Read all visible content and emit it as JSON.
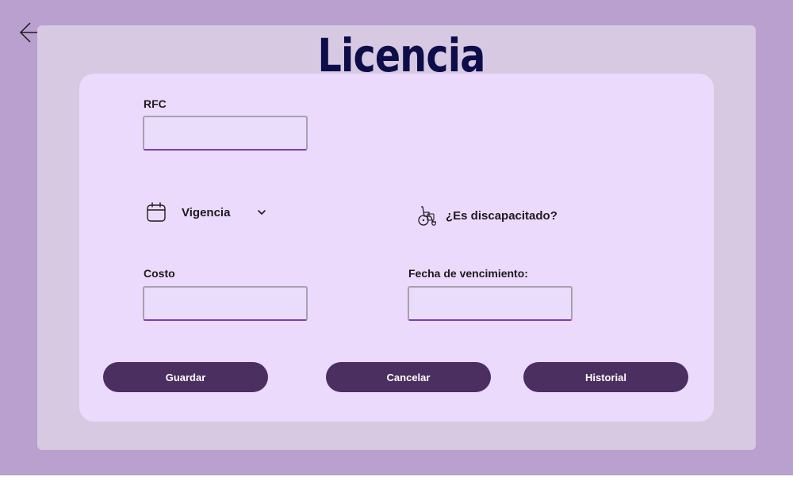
{
  "header": {
    "title": "Licencia",
    "back_icon": "arrow-left-icon"
  },
  "form": {
    "rfc": {
      "label": "RFC",
      "value": "",
      "placeholder": ""
    },
    "vigencia": {
      "label": "Vigencia",
      "icon": "calendar-icon",
      "chevron_icon": "chevron-down-icon"
    },
    "discapacitado": {
      "label": "¿Es discapacitado?",
      "icon": "wheelchair-icon"
    },
    "costo": {
      "label": "Costo",
      "value": "",
      "placeholder": ""
    },
    "fecha_vencimiento": {
      "label": "Fecha de vencimiento:",
      "value": "",
      "placeholder": ""
    }
  },
  "actions": {
    "save_label": "Guardar",
    "cancel_label": "Cancelar",
    "history_label": "Historial"
  },
  "colors": {
    "background": "#b9a0cf",
    "outer_panel": "#d8c9e2",
    "card": "#ecdafd",
    "title": "#0d0d4a",
    "button": "#4b2f60",
    "input_underline": "#7b3fb3"
  }
}
